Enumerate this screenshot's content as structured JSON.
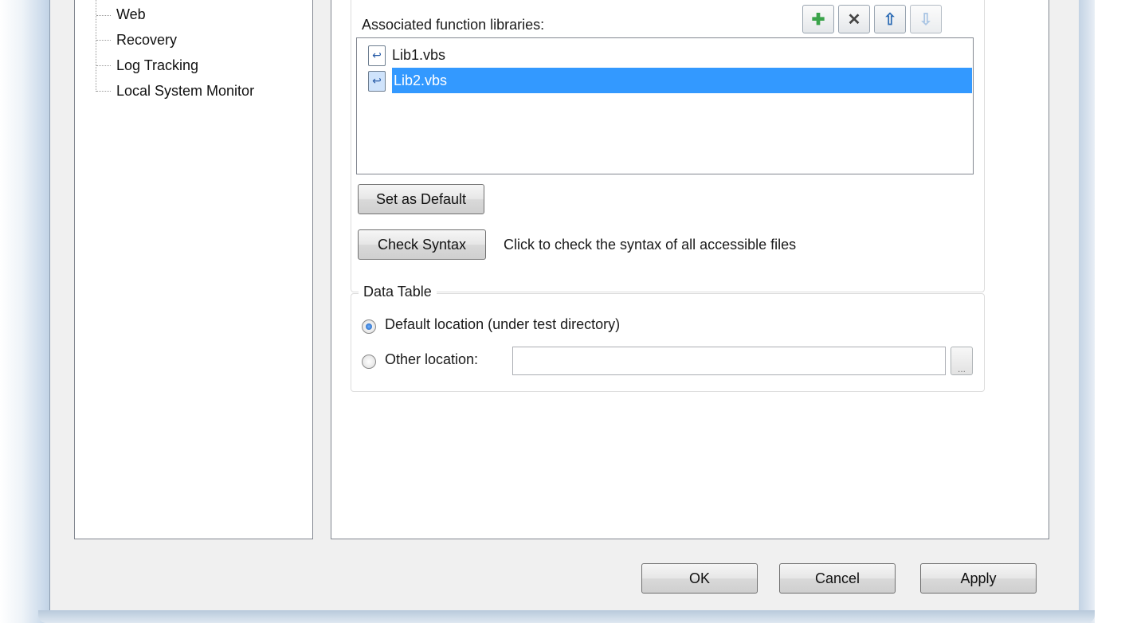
{
  "tree": {
    "items": [
      {
        "label": "Web"
      },
      {
        "label": "Recovery"
      },
      {
        "label": "Log Tracking"
      },
      {
        "label": "Local System Monitor"
      }
    ]
  },
  "resources": {
    "libraries_label": "Associated function libraries:",
    "toolbar": {
      "add_icon": "plus-icon",
      "remove_icon": "x-icon",
      "up_icon": "arrow-up-icon",
      "down_icon": "arrow-down-icon"
    },
    "libraries": [
      {
        "name": "Lib1.vbs",
        "selected": false
      },
      {
        "name": "Lib2.vbs",
        "selected": true
      }
    ],
    "set_default_button": "Set as Default",
    "check_syntax_button": "Check Syntax",
    "check_syntax_hint": "Click to check the syntax of all accessible files"
  },
  "data_table": {
    "legend": "Data Table",
    "default_location_label": "Default location (under test directory)",
    "default_location_selected": true,
    "other_location_label": "Other location:",
    "other_location_selected": false,
    "other_location_value": "",
    "browse_label": "..."
  },
  "footer": {
    "ok": "OK",
    "cancel": "Cancel",
    "apply": "Apply"
  },
  "colors": {
    "selection": "#3399ff",
    "dialog_bg": "#f0f0f0",
    "add_icon": "#3aa34a",
    "up_icon": "#2f6db5",
    "down_icon": "#8fb4dc"
  }
}
